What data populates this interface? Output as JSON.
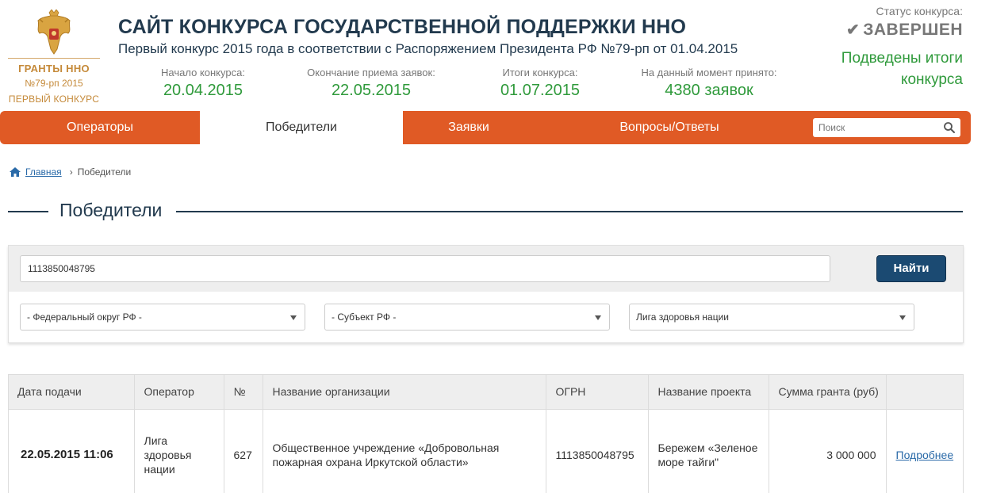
{
  "logo": {
    "emblem_icon": "russian-double-headed-eagle-emblem",
    "title": "ГРАНТЫ ННО",
    "subtitle": "№79-рп 2015",
    "tagline": "ПЕРВЫЙ КОНКУРС"
  },
  "header": {
    "title": "САЙТ КОНКУРСА ГОСУДАРСТВЕННОЙ ПОДДЕРЖКИ ННО",
    "subtitle": "Первый конкурс 2015 года в соответствии с Распоряжением Президента РФ №79-рп от 01.04.2015",
    "stats": [
      {
        "label": "Начало конкурса:",
        "value": "20.04.2015"
      },
      {
        "label": "Окончание приема заявок:",
        "value": "22.05.2015"
      },
      {
        "label": "Итоги конкурса:",
        "value": "01.07.2015"
      },
      {
        "label": "На данный момент принято:",
        "value": "4380 заявок"
      }
    ],
    "status": {
      "label": "Статус конкурса:",
      "value": "ЗАВЕРШЕН",
      "icon": "check-icon",
      "result_line1": "Подведены итоги",
      "result_line2": "конкурса"
    }
  },
  "nav": {
    "items": [
      {
        "label": "Операторы",
        "active": false
      },
      {
        "label": "Победители",
        "active": true
      },
      {
        "label": "Заявки",
        "active": false
      },
      {
        "label": "Вопросы/Ответы",
        "active": false
      }
    ],
    "search_placeholder": "Поиск"
  },
  "breadcrumb": {
    "home_icon": "home-icon",
    "home": "Главная",
    "current": "Победители"
  },
  "section": {
    "title": "Победители"
  },
  "filters": {
    "search_value": "1113850048795",
    "find_label": "Найти",
    "district": "- Федеральный округ РФ -",
    "region": "- Субъект РФ -",
    "operator": "Лига здоровья нации"
  },
  "table": {
    "columns": [
      "Дата подачи",
      "Оператор",
      "№",
      "Название организации",
      "ОГРН",
      "Название проекта",
      "Сумма гранта (руб)",
      ""
    ],
    "rows": [
      {
        "date": "22.05.2015 11:06",
        "operator": "Лига здоровья нации",
        "number": "627",
        "organization": "Общественное учреждение «Добровольная пожарная охрана Иркутской области»",
        "ogrn": "1113850048795",
        "project": "Бережем «Зеленое море тайги\"",
        "amount": "3 000 000",
        "details": "Подробнее"
      }
    ]
  },
  "colors": {
    "accent_orange": "#e05a25",
    "title_navy": "#223a4e",
    "status_green": "#2f9a3b",
    "logo_gold": "#c58a3a",
    "button_navy": "#1b4a72"
  }
}
